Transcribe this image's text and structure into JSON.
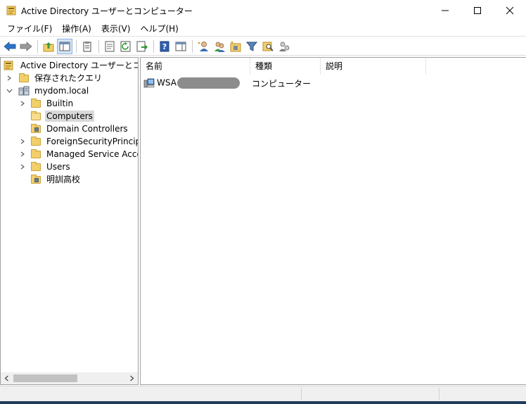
{
  "window": {
    "title": "Active Directory ユーザーとコンピューター",
    "minimize_icon": "minimize-icon",
    "maximize_icon": "maximize-icon",
    "close_icon": "close-icon"
  },
  "menu": {
    "items": [
      "ファイル(F)",
      "操作(A)",
      "表示(V)",
      "ヘルプ(H)"
    ]
  },
  "toolbar": {
    "buttons": [
      "back-arrow-icon",
      "forward-arrow-icon",
      "up-folder-icon",
      "show-hide-tree-icon",
      "clipboard-icon",
      "properties-icon",
      "refresh-icon",
      "export-list-icon",
      "help-icon",
      "action-pane-icon",
      "new-user-icon",
      "new-group-icon",
      "new-ou-icon",
      "filter-icon",
      "find-icon",
      "add-to-group-icon"
    ]
  },
  "tree": {
    "root": "Active Directory ユーザーとコンピュー",
    "saved_queries": "保存されたクエリ",
    "domain": "mydom.local",
    "children": [
      {
        "label": "Builtin",
        "expandable": true,
        "type": "folder"
      },
      {
        "label": "Computers",
        "expandable": false,
        "type": "folder",
        "selected": true
      },
      {
        "label": "Domain Controllers",
        "expandable": false,
        "type": "ou"
      },
      {
        "label": "ForeignSecurityPrincipals",
        "expandable": true,
        "type": "folder"
      },
      {
        "label": "Managed Service Accour",
        "expandable": true,
        "type": "folder"
      },
      {
        "label": "Users",
        "expandable": true,
        "type": "folder"
      },
      {
        "label": "明訓高校",
        "expandable": false,
        "type": "ou"
      }
    ]
  },
  "list": {
    "columns": [
      "名前",
      "種類",
      "説明"
    ],
    "rows": [
      {
        "name": "WSA",
        "type": "コンピューター",
        "description": ""
      }
    ]
  },
  "colors": {
    "accent": "#2b73c7",
    "folder": "#f3cf6a",
    "selected_bg": "#d9d9d9"
  }
}
